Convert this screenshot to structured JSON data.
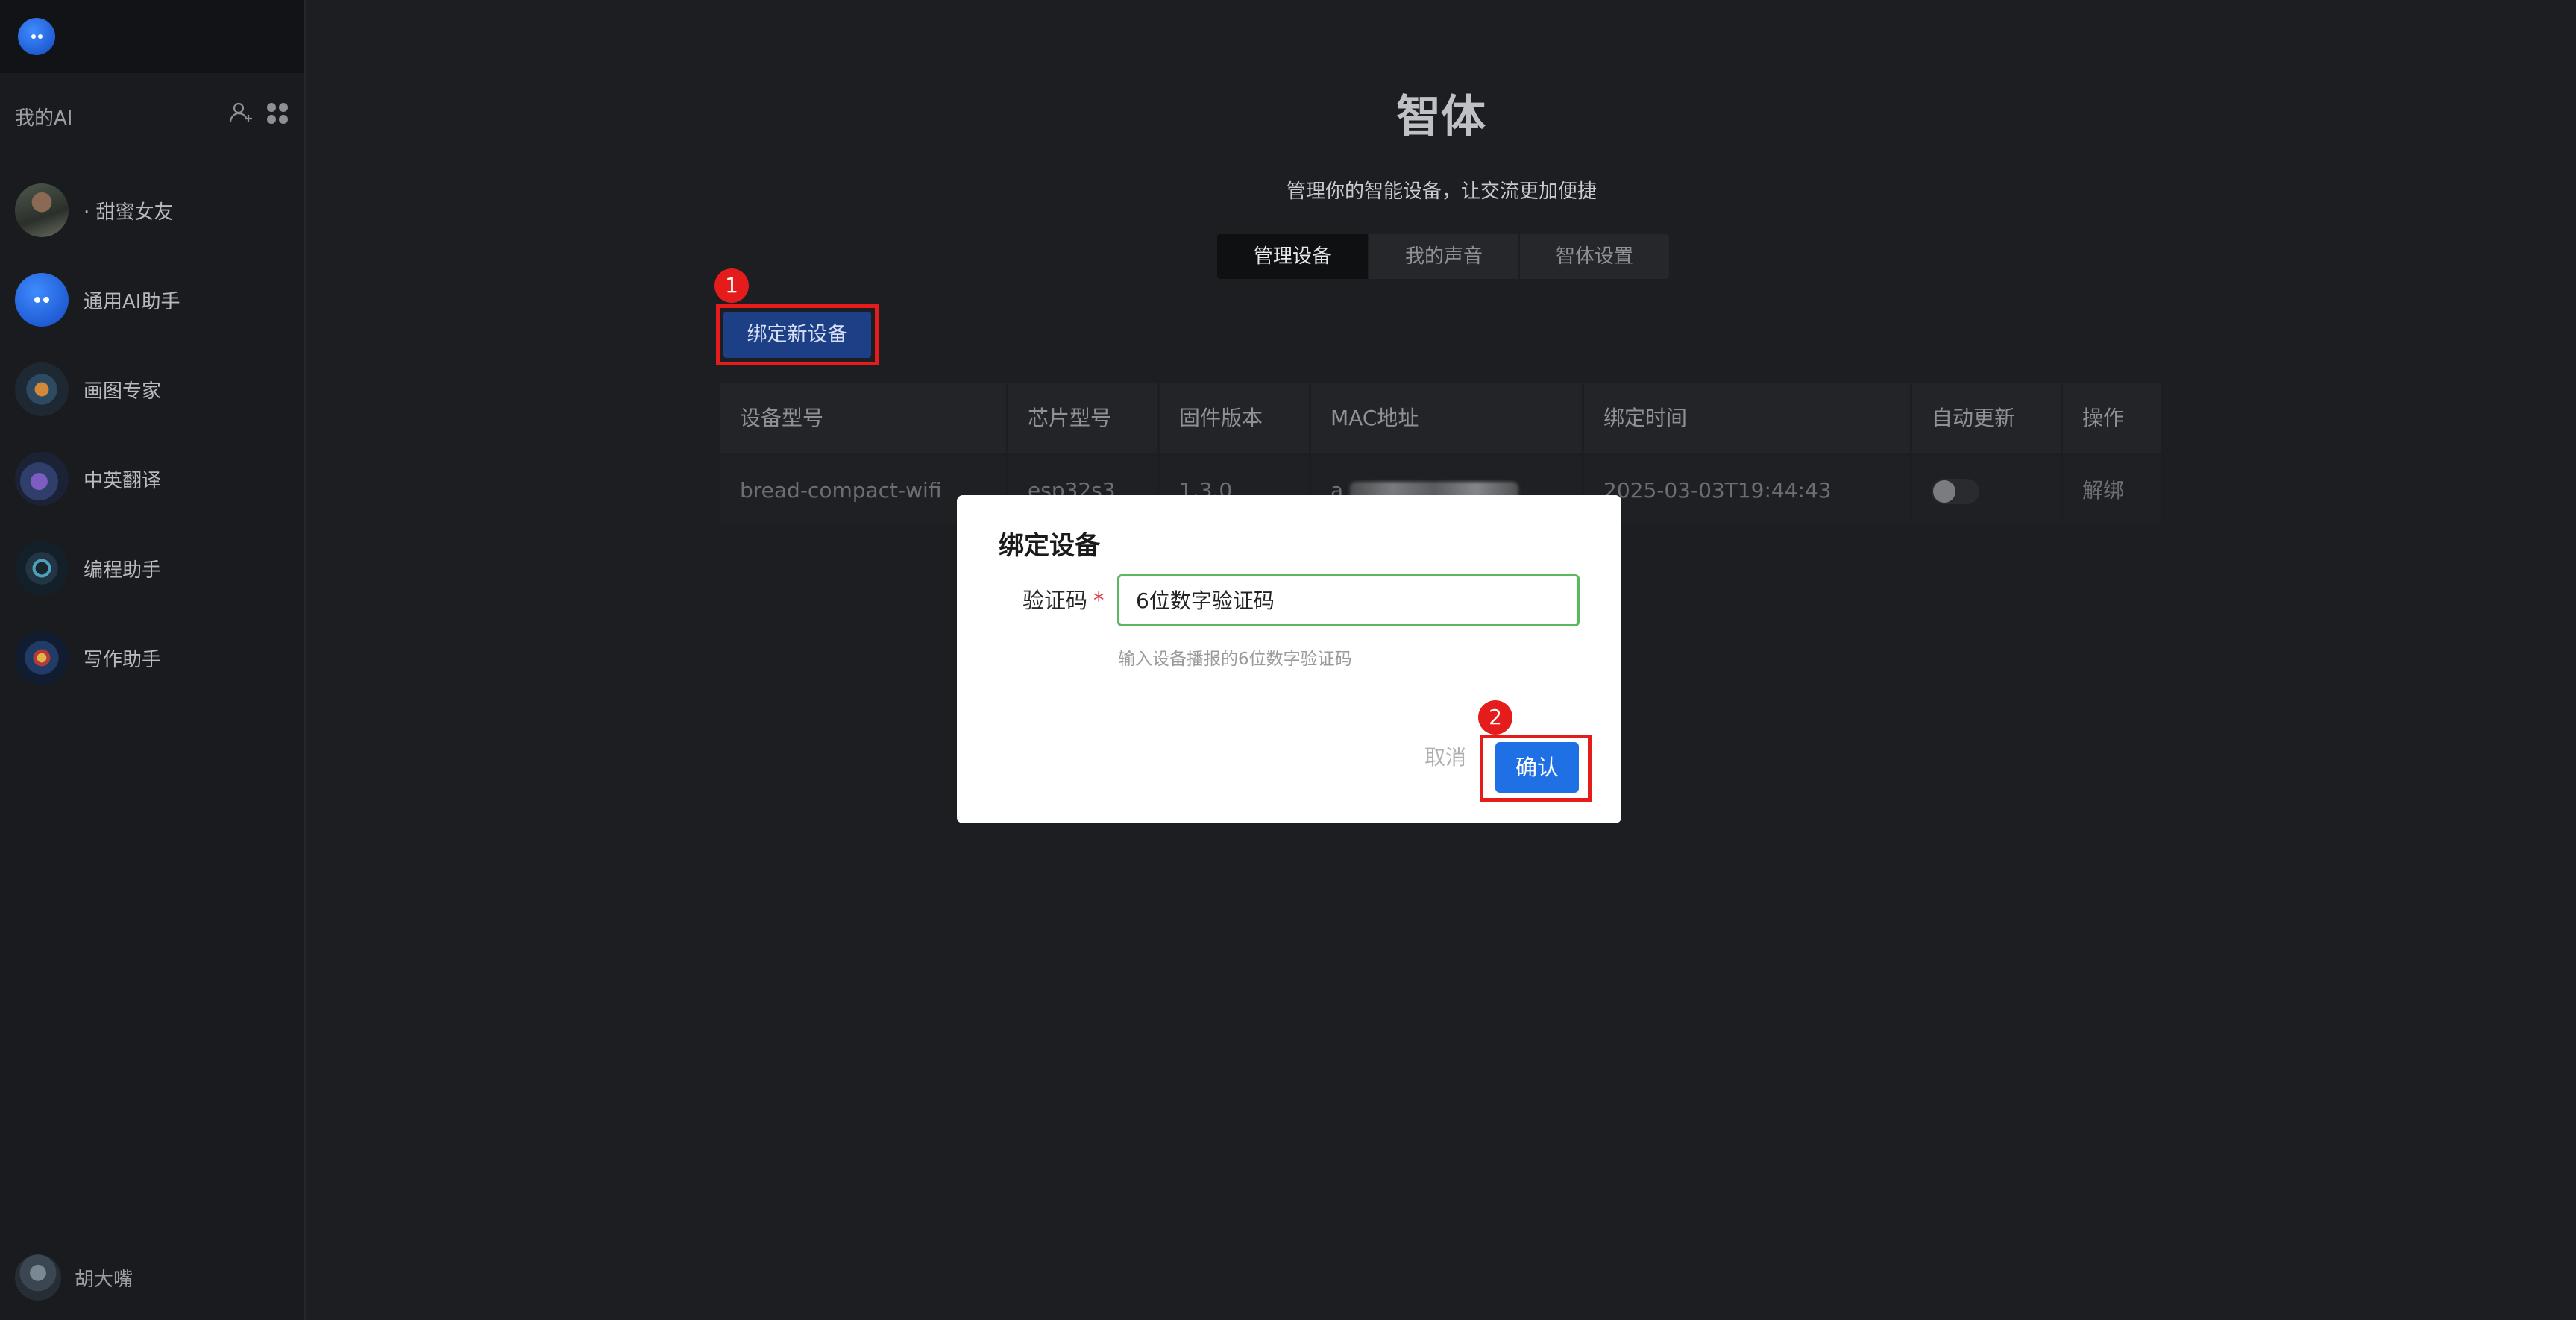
{
  "sidebar": {
    "header_title": "我的AI",
    "agents": [
      {
        "name": "· 甜蜜女友",
        "icon": "girlfriend-avatar"
      },
      {
        "name": "通用AI助手",
        "icon": "chat-bubble-avatar"
      },
      {
        "name": "画图专家",
        "icon": "painting-avatar"
      },
      {
        "name": "中英翻译",
        "icon": "translate-avatar"
      },
      {
        "name": "编程助手",
        "icon": "coding-avatar"
      },
      {
        "name": "写作助手",
        "icon": "writing-avatar"
      }
    ],
    "user": {
      "name": "胡大嘴"
    }
  },
  "main": {
    "title": "智体",
    "subtitle": "管理你的智能设备，让交流更加便捷",
    "tabs": [
      {
        "label": "管理设备",
        "active": true
      },
      {
        "label": "我的声音",
        "active": false
      },
      {
        "label": "智体设置",
        "active": false
      }
    ],
    "bind_button_label": "绑定新设备",
    "annotations": {
      "step1": "1",
      "step2": "2"
    },
    "table": {
      "headers": [
        "设备型号",
        "芯片型号",
        "固件版本",
        "MAC地址",
        "绑定时间",
        "自动更新",
        "操作"
      ],
      "rows": [
        {
          "model": "bread-compact-wifi",
          "chip": "esp32s3",
          "firmware": "1.3.0",
          "mac_prefix": "a",
          "bind_time": "2025-03-03T19:44:43",
          "auto_update": false,
          "action": "解绑"
        }
      ]
    }
  },
  "modal": {
    "title": "绑定设备",
    "field_label": "验证码",
    "required_mark": "*",
    "input_placeholder": "6位数字验证码",
    "help_text": "输入设备播报的6位数字验证码",
    "cancel_label": "取消",
    "confirm_label": "确认"
  },
  "colors": {
    "annotation_red": "#e51c1c",
    "primary_blue": "#1f6fe5",
    "input_focus_green": "#5cb85c"
  }
}
